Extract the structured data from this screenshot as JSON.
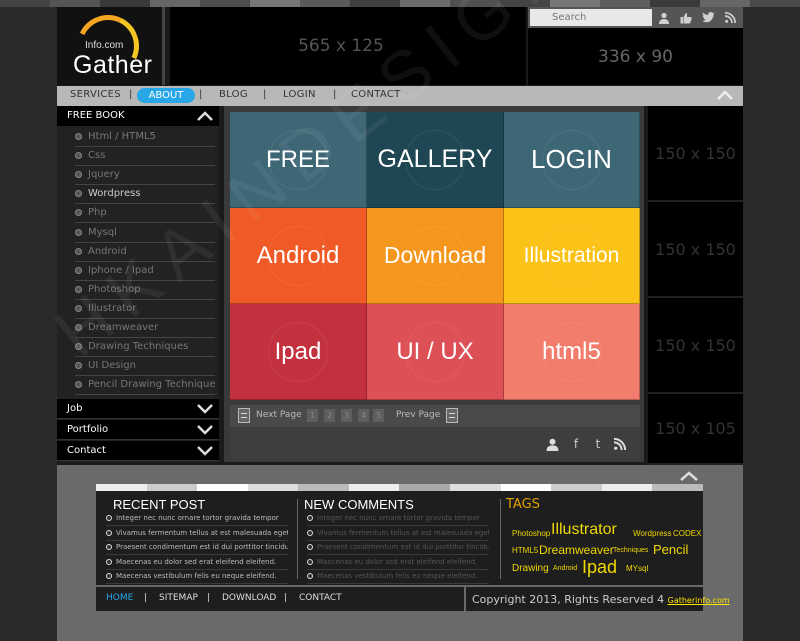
{
  "brand": {
    "small": "Info.com",
    "big": "Gather"
  },
  "ads": {
    "banner_565": "565 x 125",
    "banner_336": "336 x 90",
    "side": [
      "150 x 150",
      "150 x 150",
      "150 x 150",
      "150 x 105"
    ]
  },
  "search": {
    "placeholder": "Search"
  },
  "social_icons": [
    "user-icon",
    "thumbs-up-icon",
    "twitter-icon",
    "rss-icon"
  ],
  "nav": {
    "items": [
      "SERVICES",
      "ABOUT",
      "BLOG",
      "LOGIN",
      "CONTACT"
    ],
    "active": "ABOUT"
  },
  "sidebar": {
    "title": "FREE BOOK",
    "items": [
      "Html / HTML5",
      "Css",
      "Jquery",
      "Wordpress",
      "Php",
      "Mysql",
      "Android",
      "Iphone / Ipad",
      "Photoshop",
      "Illustrator",
      "Dreamweaver",
      "Drawing Techniques",
      "UI Design",
      "Pencil Drawing Techniques"
    ],
    "highlighted_index": 3,
    "accordions": [
      "Job",
      "Portfolio",
      "Contact"
    ]
  },
  "tiles": [
    {
      "label": "FREE",
      "color": "#3e6776"
    },
    {
      "label": "GALLERY",
      "color": "#1f4653"
    },
    {
      "label": "LOGIN",
      "color": "#3e6776"
    },
    {
      "label": "Android",
      "color": "#ef5a27"
    },
    {
      "label": "Download",
      "color": "#f6971d"
    },
    {
      "label": "Illustration",
      "color": "#fbc217"
    },
    {
      "label": "Ipad",
      "color": "#c2313d"
    },
    {
      "label": "UI / UX",
      "color": "#dd5056"
    },
    {
      "label": "html5",
      "color": "#f27d6c"
    }
  ],
  "pager": {
    "next_label": "Next Page",
    "prev_label": "Prev Page",
    "pages": [
      "1",
      "2",
      "3",
      "4",
      "5"
    ]
  },
  "share_icons": [
    "user-icon",
    "f",
    "t",
    "rss-icon"
  ],
  "footer": {
    "recent_post": {
      "title": "RECENT POST",
      "items": [
        "Integer nec nunc ornare tortor gravida tempor",
        "Vivamus fermentum tellus at est malesuada eget",
        "Praesent condimentum est id dui porttitor tincidunt.",
        "Maecenas eu dolor sed erat eleifend eleifend.",
        "Maecenas vestibulum felis eu neque eleifend."
      ]
    },
    "new_comments": {
      "title": "NEW COMMENTS",
      "items": [
        "Integer nec nunc ornare tortor gravida tempor",
        "Vivamus fermentum tellus at est malesuada eget",
        "Praesent condimentum est id dui porttitor tincidunt.",
        "Maecenas eu dolor sed erat eleifend eleifend.",
        "Maecenas vestibulum felis eu neque eleifend."
      ]
    },
    "tags": {
      "title": "TAGS",
      "items": [
        "Photoshop",
        "Illustrator",
        "Wordpress",
        "CODEX",
        "HTML5",
        "Dreamweaver",
        "Techniques",
        "Pencil",
        "Drawing",
        "Android",
        "Ipad",
        "MYsql"
      ]
    },
    "nav": [
      "HOME",
      "SITEMAP",
      "DOWNLOAD",
      "CONTACT"
    ],
    "copyright": "Copyright 2013, Rights Reserved 4",
    "copyright_link": "Gatherinfo.com"
  },
  "watermark": "HKAINDESIGN"
}
